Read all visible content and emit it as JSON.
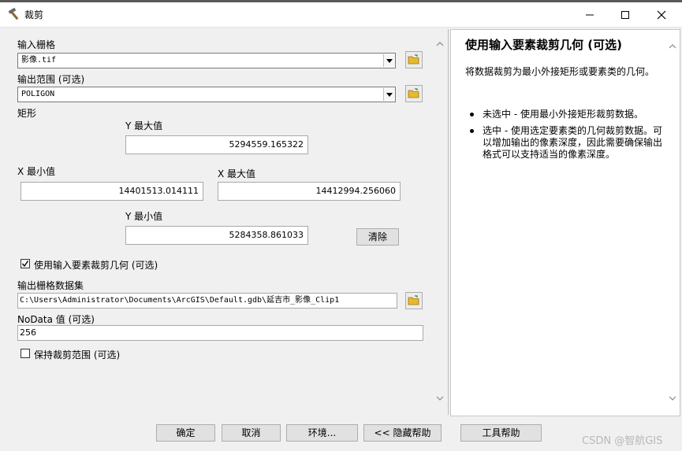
{
  "window": {
    "title": "裁剪",
    "icons": {
      "app": "hammer-icon",
      "minimize": "minimize-icon",
      "maximize": "maximize-icon",
      "close": "close-icon"
    }
  },
  "form": {
    "input_raster_label": "输入栅格",
    "input_raster_value": "影像.tif",
    "output_extent_label": "输出范围 (可选)",
    "output_extent_value": "POLIGON",
    "rectangle_label": "矩形",
    "y_max_label": "Y 最大值",
    "y_max_value": "5294559.165322",
    "x_min_label": "X 最小值",
    "x_min_value": "14401513.014111",
    "x_max_label": "X 最大值",
    "x_max_value": "14412994.256060",
    "y_min_label": "Y 最小值",
    "y_min_value": "5284358.861033",
    "clear_button": "清除",
    "use_geometry_label": "使用输入要素裁剪几何 (可选)",
    "use_geometry_checked": true,
    "output_dataset_label": "输出栅格数据集",
    "output_dataset_value": "C:\\Users\\Administrator\\Documents\\ArcGIS\\Default.gdb\\延吉市_影像_Clip1",
    "nodata_label": "NoData 值 (可选)",
    "nodata_value": "256",
    "maintain_extent_label": "保持裁剪范围 (可选)",
    "maintain_extent_checked": false
  },
  "help": {
    "title": "使用输入要素裁剪几何 (可选)",
    "description": "将数据裁剪为最小外接矩形或要素类的几何。",
    "items": [
      "未选中 - 使用最小外接矩形裁剪数据。",
      "选中 - 使用选定要素类的几何裁剪数据。可以增加输出的像素深度，因此需要确保输出格式可以支持适当的像素深度。"
    ]
  },
  "buttons": {
    "ok": "确定",
    "cancel": "取消",
    "environments": "环境...",
    "hide_help": "<< 隐藏帮助",
    "tool_help": "工具帮助"
  },
  "watermark": "CSDN @智航GIS",
  "colors": {
    "folder": "#e8b830",
    "title_text": "#000000",
    "panel_bg": "#f0f0f0"
  }
}
